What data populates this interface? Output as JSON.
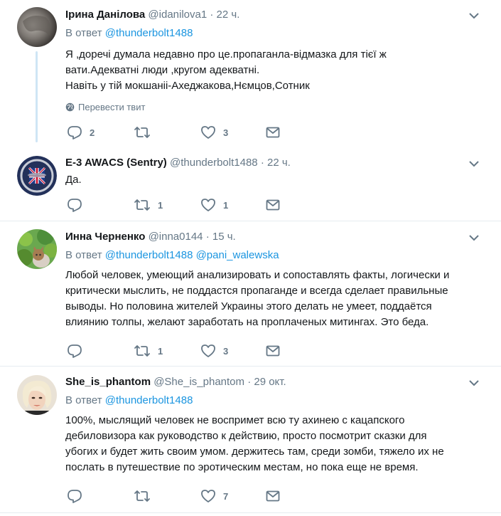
{
  "colors": {
    "link": "#1b95e0",
    "muted": "#657786",
    "text": "#14171a",
    "thread_line": "#cfe5f5",
    "divider": "#e6ecf0"
  },
  "translate_label": "Перевести твит",
  "tweets": [
    {
      "name": "Ірина Данілова",
      "handle": "@idanilova1",
      "time": "· 22 ч.",
      "reply_prefix": "В ответ",
      "reply_to": [
        "@thunderbolt1488"
      ],
      "text": [
        "Я ,доречі думала недавно про це.пропаганла-відмазка для тієї ж",
        "вати.Адекватні люди ,кругом адекватні.",
        "Навіть у тій мокшаніі-Ахеджакова,Нємцов,Сотник"
      ],
      "replies": "2",
      "retweets": "",
      "likes": "3"
    },
    {
      "name": "E-3 AWACS (Sentry)",
      "handle": "@thunderbolt1488",
      "time": "· 22 ч.",
      "text": [
        "Да."
      ],
      "replies": "",
      "retweets": "1",
      "likes": "1"
    },
    {
      "name": "Инна Черненко",
      "handle": "@inna0144",
      "time": "· 15 ч.",
      "reply_prefix": "В ответ",
      "reply_to": [
        "@thunderbolt1488",
        "@pani_walewska"
      ],
      "text": [
        "Любой человек, умеющий анализировать и сопоставлять факты, логически и",
        "критически мыслить, не поддастся пропаганде и всегда сделает правильные",
        "выводы. Но половина жителей Украины этого делать не умеет, поддаётся",
        "влиянию толпы, желают заработать на проплаченых митингах. Это беда."
      ],
      "replies": "",
      "retweets": "1",
      "likes": "3"
    },
    {
      "name": "She_is_phantom",
      "handle": "@She_is_phantom",
      "time": "· 29 окт.",
      "reply_prefix": "В ответ",
      "reply_to": [
        "@thunderbolt1488"
      ],
      "text": [
        "100%, мыслящий человек не воспримет всю ту ахинею с кацапского",
        "дебиловизора как руководство к действию, просто посмотрит сказки для",
        "убогих и будет жить своим умом. держитесь там, среди зомби, тяжело их не",
        "послать в путешествие по эротическим местам, но пока еще не время."
      ],
      "replies": "",
      "retweets": "",
      "likes": "7"
    }
  ]
}
